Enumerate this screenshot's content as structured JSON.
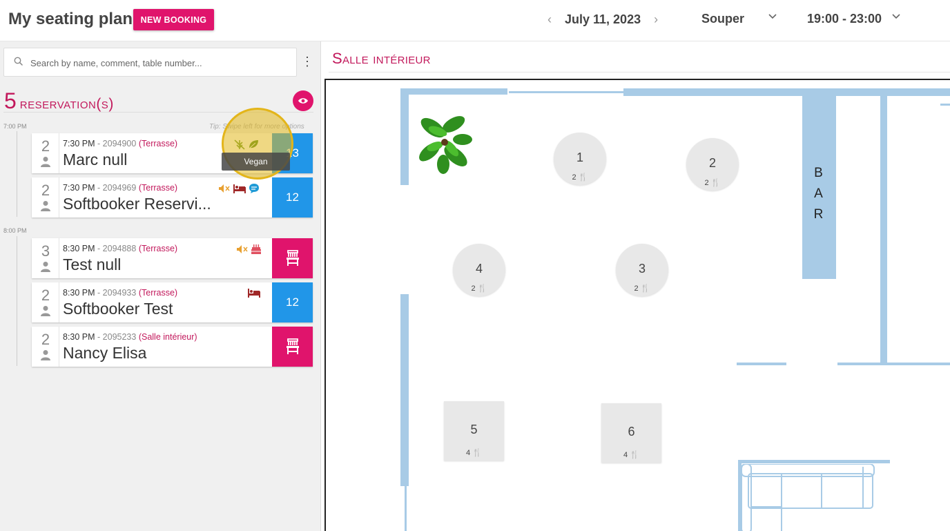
{
  "header": {
    "title": "My seating plan",
    "new_booking": "NEW BOOKING",
    "date": "July 11, 2023",
    "service": "Souper",
    "time_range": "19:00 - 23:00"
  },
  "sidebar": {
    "search_placeholder": "Search by name, comment, table number...",
    "reservation_count": "5",
    "reservation_label": "reservation(s)",
    "tip": "Tip: Swipe left for more options",
    "groups": [
      {
        "time": "7:00 PM"
      },
      {
        "time": "8:00 PM"
      }
    ],
    "reservations": [
      {
        "covers": "2",
        "time": "7:30 PM",
        "ref": "2094900",
        "area": "(Terrasse)",
        "name": "Marc null",
        "table": "13",
        "icons": [
          "no-gluten-icon",
          "vegan-leaf-icon"
        ]
      },
      {
        "covers": "2",
        "time": "7:30 PM",
        "ref": "2094969",
        "area": "(Terrasse)",
        "name": "Softbooker Reservi...",
        "table": "12",
        "icons": [
          "mute-icon",
          "bed-icon",
          "comment-icon"
        ]
      },
      {
        "covers": "3",
        "time": "8:30 PM",
        "ref": "2094888",
        "area": "(Terrasse)",
        "name": "Test null",
        "table": "",
        "icons": [
          "mute-icon",
          "cake-icon"
        ]
      },
      {
        "covers": "2",
        "time": "8:30 PM",
        "ref": "2094933",
        "area": "(Terrasse)",
        "name": "Softbooker Test",
        "table": "12",
        "icons": [
          "bed-icon"
        ]
      },
      {
        "covers": "2",
        "time": "8:30 PM",
        "ref": "2095233",
        "area": "(Salle intérieur)",
        "name": "Nancy Elisa",
        "table": "",
        "icons": []
      }
    ],
    "tooltip": "Vegan"
  },
  "floor": {
    "title": "Salle intérieur",
    "bar_letters": [
      "B",
      "A",
      "R"
    ],
    "tables": [
      {
        "number": "1",
        "seats": "2"
      },
      {
        "number": "2",
        "seats": "2"
      },
      {
        "number": "4",
        "seats": "2"
      },
      {
        "number": "3",
        "seats": "2"
      },
      {
        "number": "5",
        "seats": "4"
      },
      {
        "number": "6",
        "seats": "4"
      }
    ]
  },
  "colors": {
    "accent": "#e0146c",
    "title_pink": "#c2185b",
    "table_blue": "#2196e8",
    "wall": "#a8cbe6"
  }
}
